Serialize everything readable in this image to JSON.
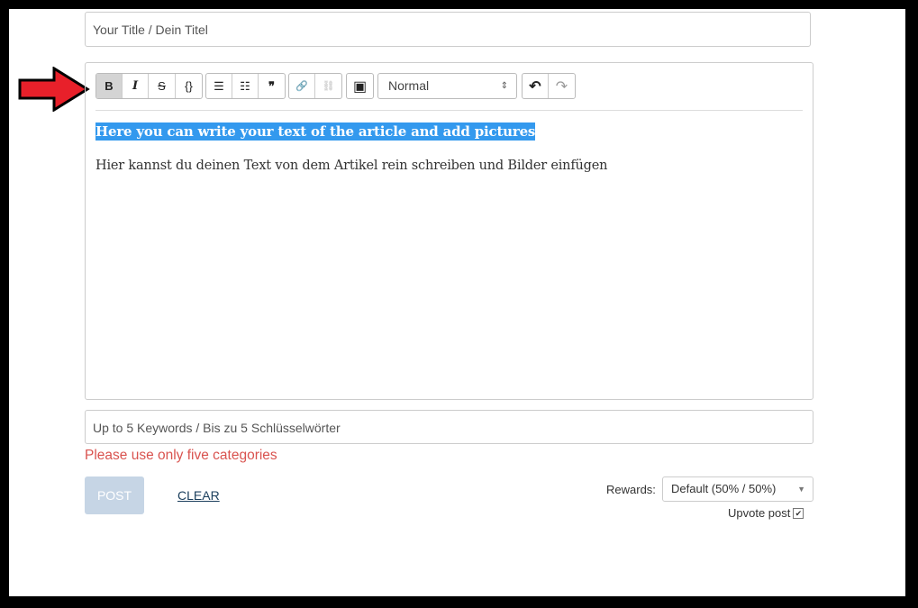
{
  "title_input": {
    "placeholder": "Your Title / Dein Titel"
  },
  "toolbar": {
    "bold": "B",
    "italic": "I",
    "strike": "S",
    "code": "{}",
    "bullet": "☰",
    "ordered": "☷",
    "quote": "❞",
    "link": "🔗",
    "unlink": "⛓",
    "image": "▣",
    "format_select": "Normal",
    "undo": "↶",
    "redo": "↷"
  },
  "editor": {
    "heading": "Here you can write your text of the article and add pictures",
    "paragraph": "Hier kannst du deinen Text von dem Artikel rein schreiben und Bilder einfügen",
    "highlight_color": "#3399ee"
  },
  "keywords_input": {
    "placeholder": "Up to 5 Keywords / Bis zu 5 Schlüsselwörter"
  },
  "error": "Please use only five categories",
  "actions": {
    "post": "POST",
    "clear": "CLEAR"
  },
  "rewards": {
    "label": "Rewards:",
    "value": "Default (50% / 50%)"
  },
  "upvote": {
    "label": "Upvote post",
    "checked": true
  },
  "annotation": {
    "arrow_color": "#e8202a"
  }
}
